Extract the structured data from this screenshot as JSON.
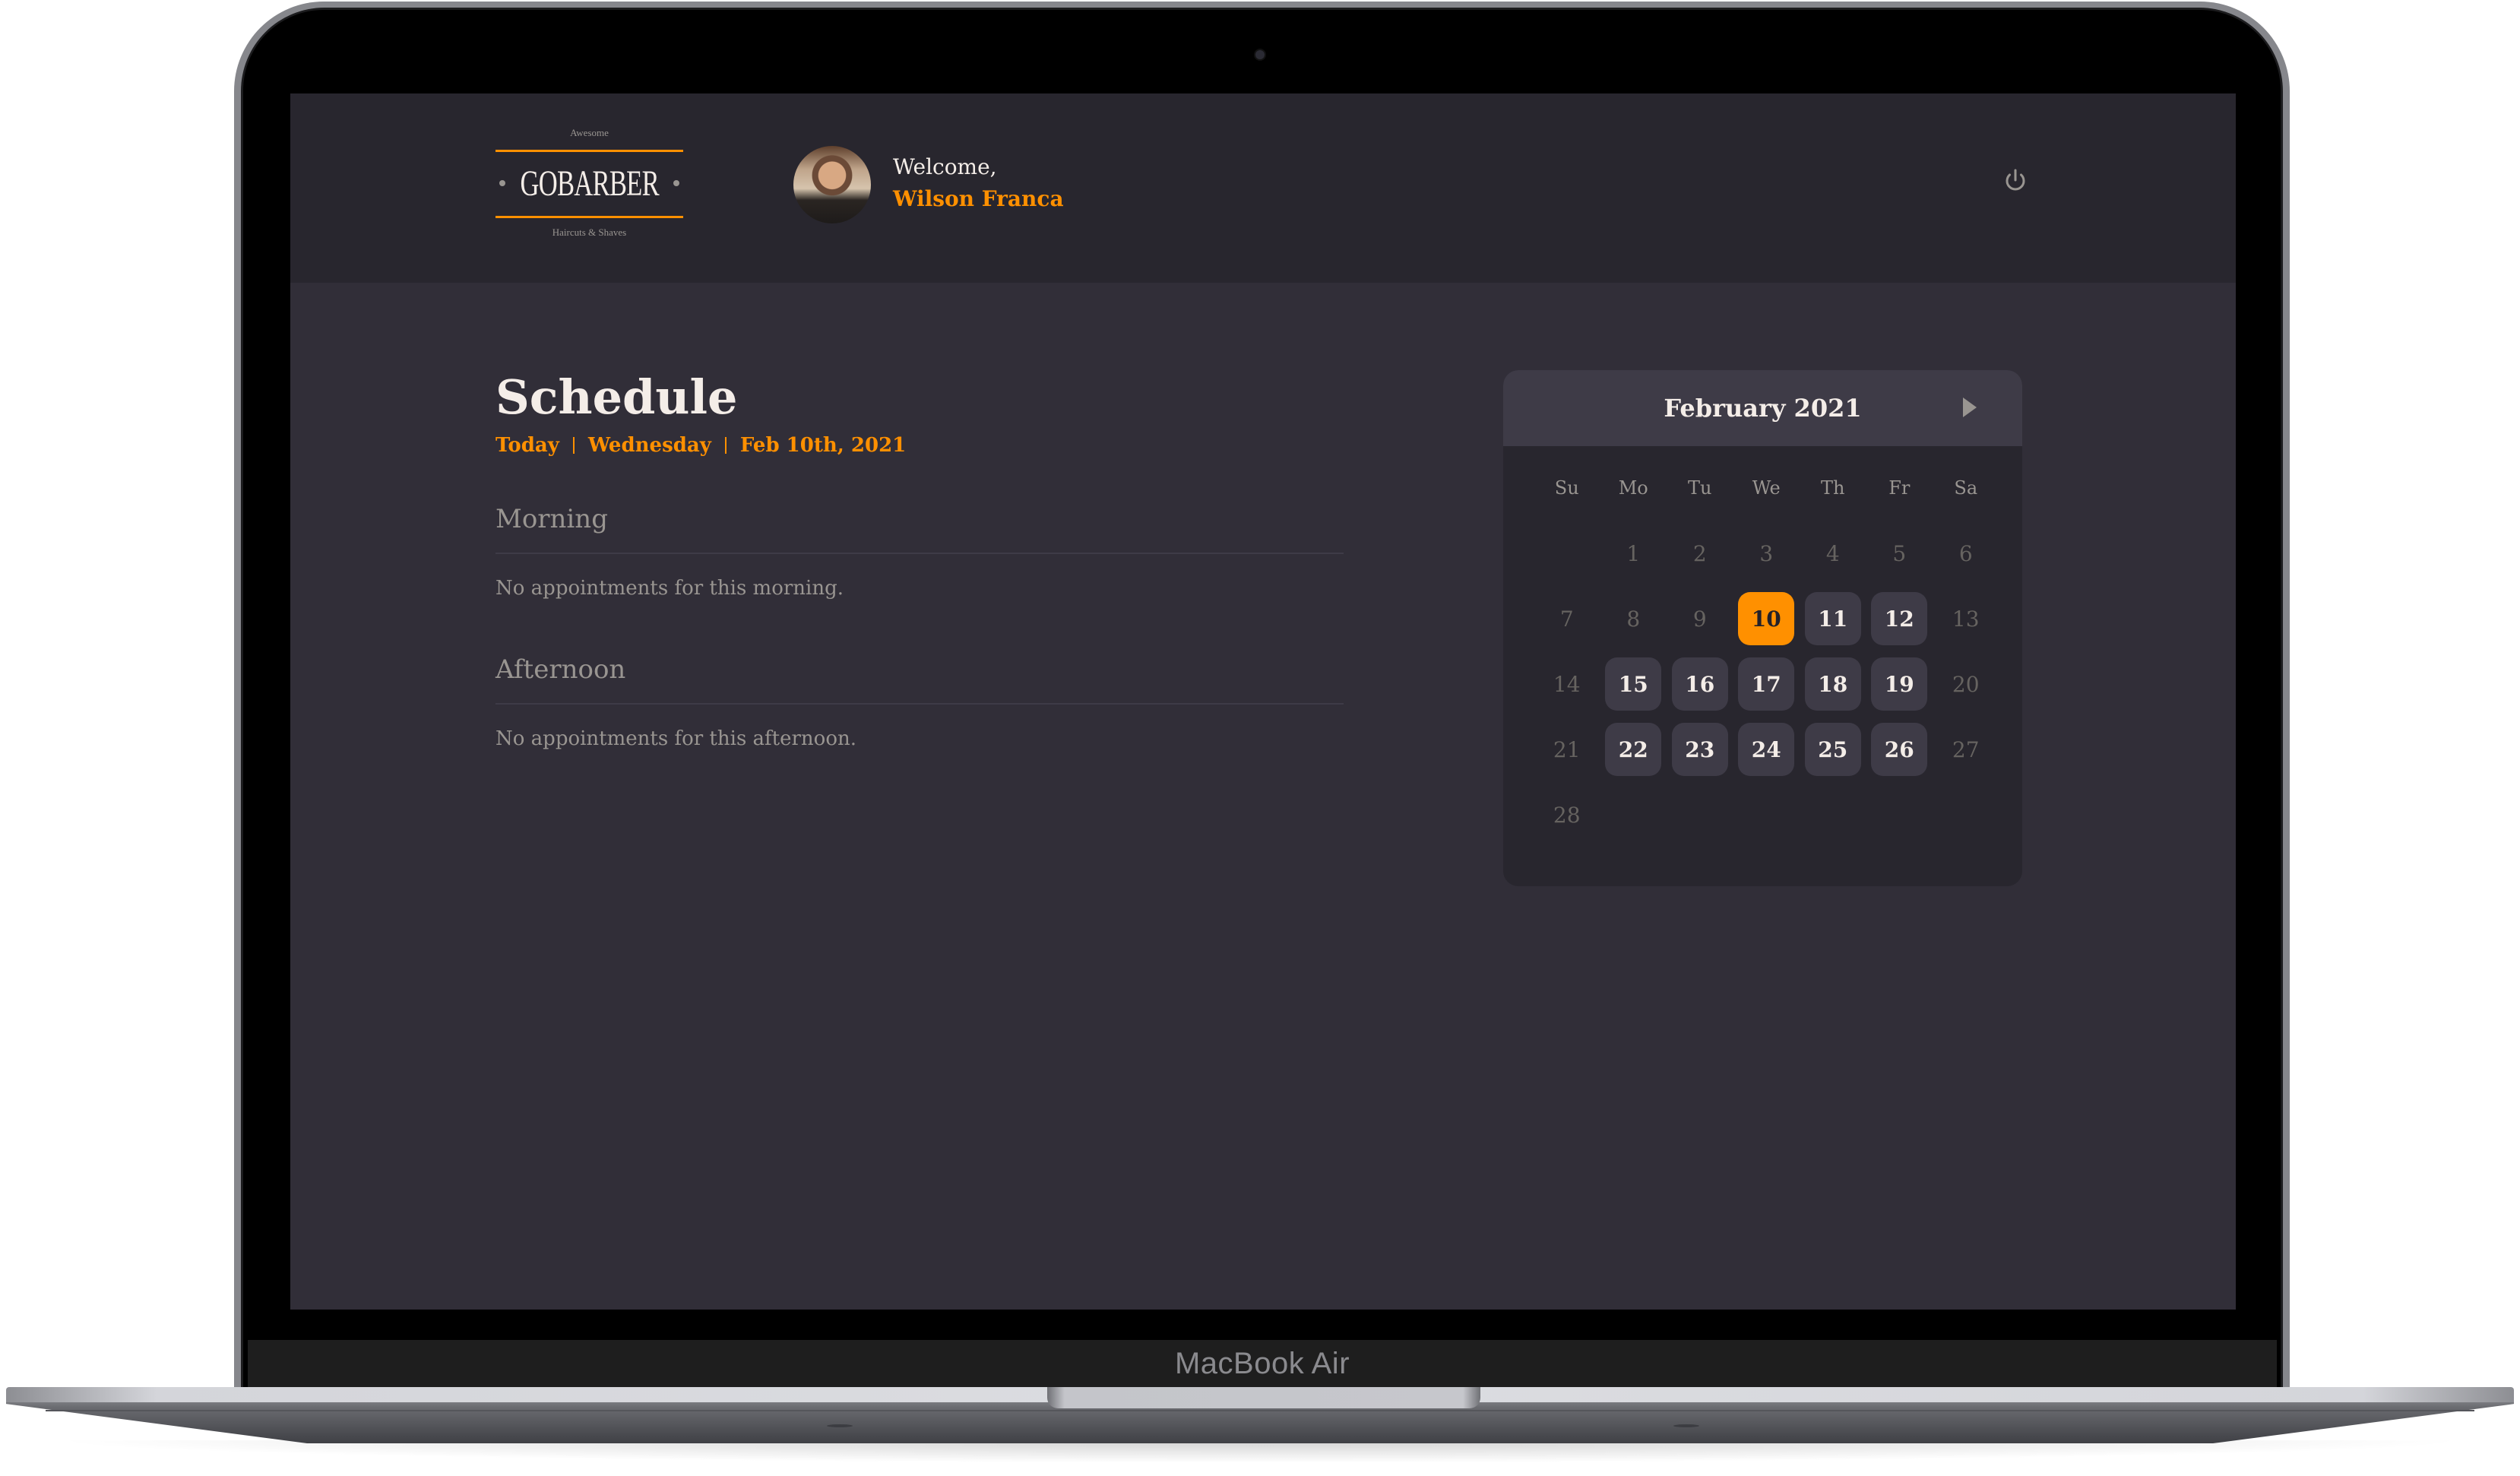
{
  "laptop": {
    "model_label": "MacBook Air"
  },
  "header": {
    "logo": {
      "top": "Awesome",
      "main": "GOBARBER",
      "sub": "Haircuts & Shaves"
    },
    "welcome_label": "Welcome,",
    "user_name": "Wilson Franca",
    "avatar_icon": "user-avatar",
    "signout_icon": "power-icon"
  },
  "schedule": {
    "title": "Schedule",
    "date_parts": [
      "Today",
      "Wednesday",
      "Feb 10th, 2021"
    ],
    "sections": [
      {
        "title": "Morning",
        "empty_text": "No appointments for this morning."
      },
      {
        "title": "Afternoon",
        "empty_text": "No appointments for this afternoon."
      }
    ]
  },
  "calendar": {
    "month_label": "February 2021",
    "next_icon": "triangle-right-icon",
    "weekdays": [
      "Su",
      "Mo",
      "Tu",
      "We",
      "Th",
      "Fr",
      "Sa"
    ],
    "leading_blanks": 1,
    "days": [
      {
        "d": "1",
        "s": "disabled"
      },
      {
        "d": "2",
        "s": "disabled"
      },
      {
        "d": "3",
        "s": "disabled"
      },
      {
        "d": "4",
        "s": "disabled"
      },
      {
        "d": "5",
        "s": "disabled"
      },
      {
        "d": "6",
        "s": "disabled"
      },
      {
        "d": "7",
        "s": "disabled"
      },
      {
        "d": "8",
        "s": "disabled"
      },
      {
        "d": "9",
        "s": "disabled"
      },
      {
        "d": "10",
        "s": "selected"
      },
      {
        "d": "11",
        "s": "available"
      },
      {
        "d": "12",
        "s": "available"
      },
      {
        "d": "13",
        "s": "disabled"
      },
      {
        "d": "14",
        "s": "disabled"
      },
      {
        "d": "15",
        "s": "available"
      },
      {
        "d": "16",
        "s": "available"
      },
      {
        "d": "17",
        "s": "available"
      },
      {
        "d": "18",
        "s": "available"
      },
      {
        "d": "19",
        "s": "available"
      },
      {
        "d": "20",
        "s": "disabled"
      },
      {
        "d": "21",
        "s": "disabled"
      },
      {
        "d": "22",
        "s": "available"
      },
      {
        "d": "23",
        "s": "available"
      },
      {
        "d": "24",
        "s": "available"
      },
      {
        "d": "25",
        "s": "available"
      },
      {
        "d": "26",
        "s": "available"
      },
      {
        "d": "27",
        "s": "disabled"
      },
      {
        "d": "28",
        "s": "disabled"
      }
    ]
  },
  "colors": {
    "accent": "#ff9000",
    "text": "#f4ede8",
    "muted": "#999591",
    "bg": "#312e38",
    "panel": "#28262e",
    "shape": "#3e3b47"
  }
}
